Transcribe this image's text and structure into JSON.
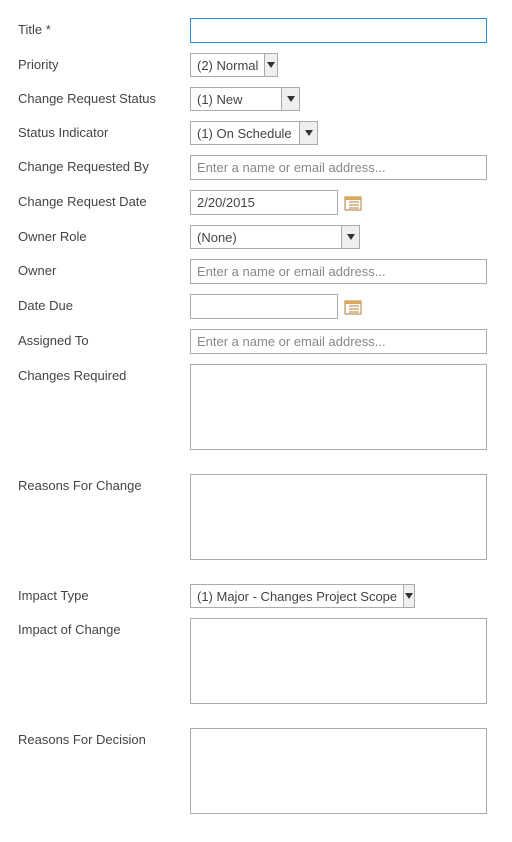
{
  "fields": {
    "title": {
      "label": "Title",
      "required": "*",
      "value": ""
    },
    "priority": {
      "label": "Priority",
      "value": "(2) Normal"
    },
    "status": {
      "label": "Change Request Status",
      "value": "(1) New"
    },
    "indicator": {
      "label": "Status Indicator",
      "value": "(1) On Schedule"
    },
    "requested_by": {
      "label": "Change Requested By",
      "placeholder": "Enter a name or email address..."
    },
    "request_date": {
      "label": "Change Request Date",
      "value": "2/20/2015"
    },
    "owner_role": {
      "label": "Owner Role",
      "value": "(None)"
    },
    "owner": {
      "label": "Owner",
      "placeholder": "Enter a name or email address..."
    },
    "date_due": {
      "label": "Date Due",
      "value": ""
    },
    "assigned_to": {
      "label": "Assigned To",
      "placeholder": "Enter a name or email address..."
    },
    "changes_required": {
      "label": "Changes Required",
      "value": ""
    },
    "reasons_change": {
      "label": "Reasons For Change",
      "value": ""
    },
    "impact_type": {
      "label": "Impact Type",
      "value": "(1) Major - Changes Project Scope"
    },
    "impact_of_change": {
      "label": "Impact of Change",
      "value": ""
    },
    "reasons_decision": {
      "label": "Reasons For Decision",
      "value": ""
    }
  }
}
